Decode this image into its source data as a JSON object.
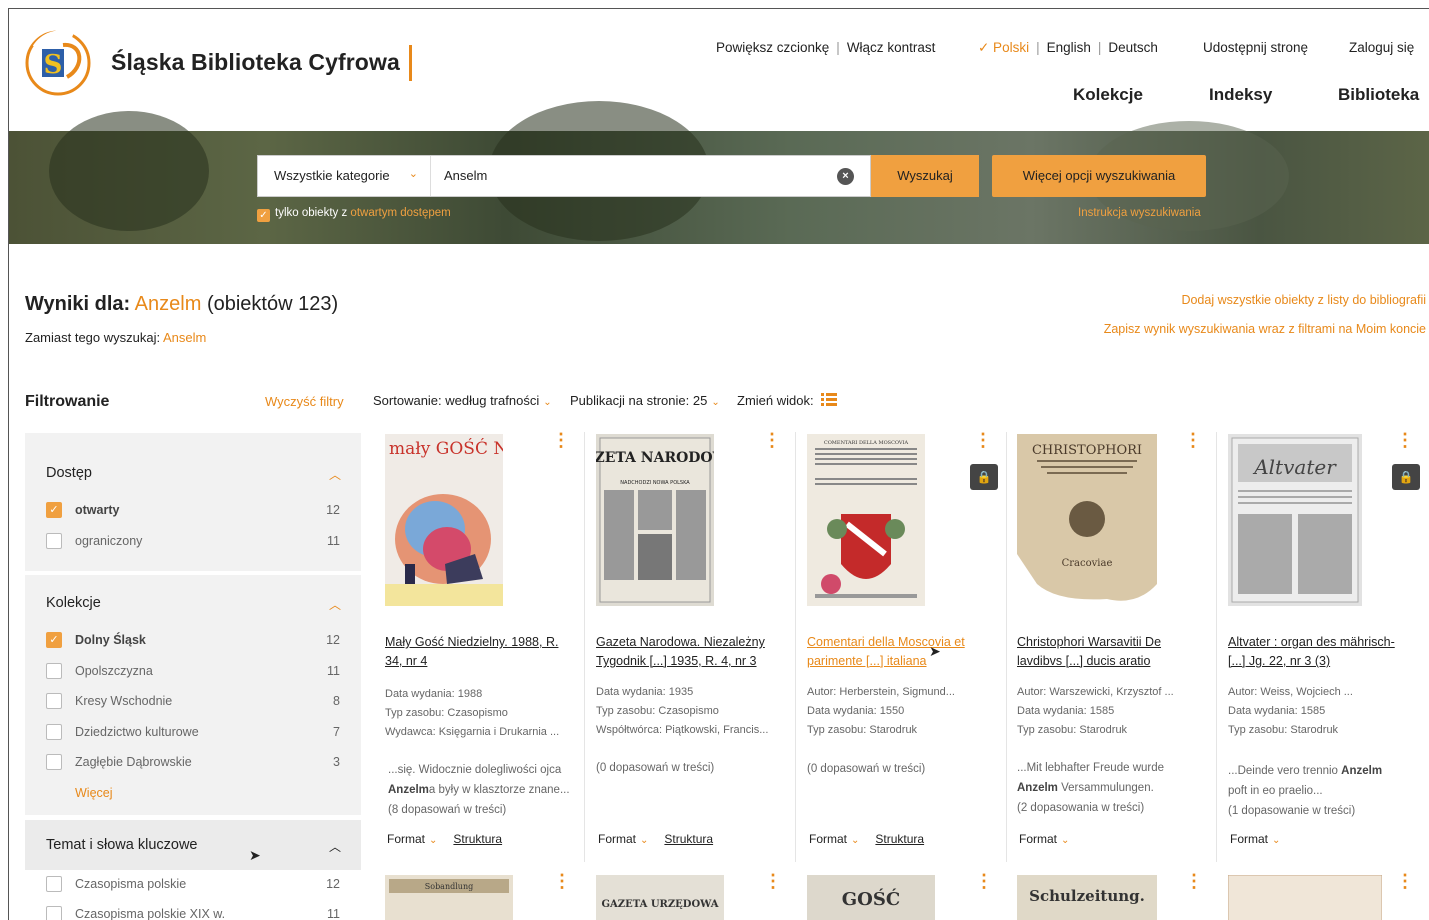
{
  "header": {
    "brand": "Śląska Biblioteka Cyfrowa",
    "enlarge_font": "Powiększ czcionkę",
    "contrast": "Włącz kontrast",
    "lang_active": "✓ Polski",
    "lang_en": "English",
    "lang_de": "Deutsch",
    "share": "Udostępnij stronę",
    "login": "Zaloguj się",
    "nav": [
      "Kolekcje",
      "Indeksy",
      "Biblioteka"
    ],
    "accent": "#e8891a"
  },
  "search": {
    "category": "Wszystkie kategorie",
    "query": "Anselm",
    "search_btn": "Wyszukaj",
    "more_btn": "Więcej opcji wyszukiwania",
    "open_only_prefix": "tylko obiekty z ",
    "open_only_link": "otwartym dostępem",
    "instructions": "Instrukcja wyszukiwania"
  },
  "results": {
    "label": "Wyniki dla:",
    "term": "Anzelm",
    "count_text": "(obiektów 123)",
    "instead_label": "Zamiast tego wyszukaj:",
    "instead_term": "Anselm",
    "add_all": "Dodaj wszystkie obiekty z listy do bibliografii",
    "save": "Zapisz wynik wyszukiwania wraz z filtrami na Moim koncie"
  },
  "filters": {
    "title": "Filtrowanie",
    "clear": "Wyczyść filtry",
    "access": {
      "heading": "Dostęp",
      "items": [
        {
          "label": "otwarty",
          "count": "12",
          "checked": true
        },
        {
          "label": "ograniczony",
          "count": "11",
          "checked": false
        }
      ]
    },
    "collections": {
      "heading": "Kolekcje",
      "items": [
        {
          "label": "Dolny Śląsk",
          "count": "12",
          "checked": true
        },
        {
          "label": "Opolszczyzna",
          "count": "11",
          "checked": false
        },
        {
          "label": "Kresy Wschodnie",
          "count": "8",
          "checked": false
        },
        {
          "label": "Dziedzictwo kulturowe",
          "count": "7",
          "checked": false
        },
        {
          "label": "Zagłębie Dąbrowskie",
          "count": "3",
          "checked": false
        }
      ],
      "more": "Więcej"
    },
    "keywords": {
      "heading": "Temat i słowa kluczowe",
      "items": [
        {
          "label": "Czasopisma polskie",
          "count": "12",
          "checked": false
        },
        {
          "label": "Czasopisma polskie XIX w.",
          "count": "11",
          "checked": false
        }
      ]
    }
  },
  "toolbar": {
    "sort": "Sortowanie: według trafności",
    "per_page": "Publikacji na stronie: 25",
    "view": "Zmień widok:"
  },
  "cards": [
    {
      "title": "Mały Gość Niedzielny. 1988, R. 34, nr 4",
      "meta": [
        "Data wydania: 1988",
        "Typ zasobu: Czasopismo",
        "Wydawca: Księgarnia i Drukarnia ..."
      ],
      "snippet_pre": "...się. Widocznie dolegliwości ojca ",
      "snippet_bold": "Anzelm",
      "snippet_post": "a były w klasztorze znane...",
      "matches": "(8 dopasowań w treści)",
      "format": "Format",
      "structure": "Struktura",
      "locked": false
    },
    {
      "title": "Gazeta Narodowa. Niezależny Tygodnik [...] 1935, R. 4, nr 3",
      "meta": [
        "Data wydania: 1935",
        "Typ zasobu: Czasopismo",
        "Współtwórca: Piątkowski, Francis..."
      ],
      "snippet_pre": "",
      "snippet_bold": "",
      "snippet_post": "",
      "matches": "(0 dopasowań w treści)",
      "format": "Format",
      "structure": "Struktura",
      "locked": false
    },
    {
      "title": "Comentari della Moscovia et parimente [...] italiana",
      "meta": [
        "Autor: Herberstein, Sigmund...",
        "Data wydania: 1550",
        "Typ zasobu: Starodruk"
      ],
      "snippet_pre": "",
      "snippet_bold": "",
      "snippet_post": "",
      "matches": "(0 dopasowań w treści)",
      "format": "Format",
      "structure": "Struktura",
      "locked": true
    },
    {
      "title": "Christophori Warsavitii De lavdibvs [...] ducis aratio",
      "meta": [
        "Autor: Warszewicki, Krzysztof ...",
        "Data wydania: 1585",
        "Typ zasobu: Starodruk"
      ],
      "snippet_pre": "...Mit lebhafter Freude wurde ",
      "snippet_bold": "Anzelm",
      "snippet_post": " Versammulungen.",
      "matches": "(2 dopasowania w treści)",
      "format": "Format",
      "structure": "",
      "locked": false
    },
    {
      "title": "Altvater : organ des mährisch- [...] Jg. 22, nr 3 (3)",
      "meta": [
        "Autor: Weiss, Wojciech ...",
        "Data wydania: 1585",
        "Typ zasobu: Starodruk"
      ],
      "snippet_pre": "...Deinde vero trennio ",
      "snippet_bold": "Anzelm",
      "snippet_post": " poft in eo praelio...",
      "matches": "(1 dopasowanie w treści)",
      "format": "Format",
      "structure": "",
      "locked": true
    }
  ],
  "thumb_texts": {
    "t1": "mały GOŚĆ NIEDZIELNY",
    "t2": "GAZETA NARODOWA",
    "t2b": "NADCHODZI NOWA POLSKA",
    "t3": "COMENTARI DELLA MOSCOVIA",
    "t4": "CHRISTOPHORI",
    "t4b": "Cracoviae",
    "t5": "Altvater",
    "r2_1": "Sobandlung",
    "r2_2": "GAZETA URZĘDOWA",
    "r2_3": "GOŚĆ",
    "r2_4": "Schulzeitung."
  }
}
